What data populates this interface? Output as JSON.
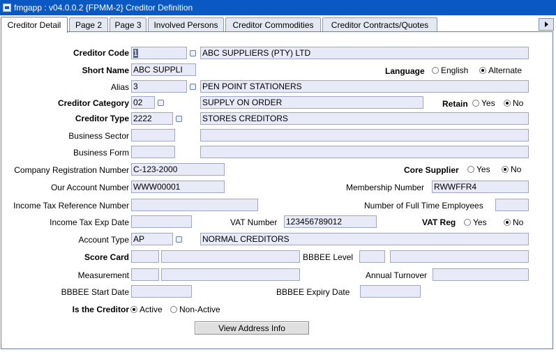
{
  "window": {
    "title": "fmgapp : v04.0.0.2  {FPMM-2} Creditor Definition"
  },
  "tabs": [
    {
      "label": "Creditor Detail"
    },
    {
      "label": "Page 2"
    },
    {
      "label": "Page 3"
    },
    {
      "label": "Involved Persons"
    },
    {
      "label": "Creditor Commodities"
    },
    {
      "label": "Creditor Contracts/Quotes"
    }
  ],
  "labels": {
    "creditor_code": "Creditor Code",
    "short_name": "Short Name",
    "alias": "Alias",
    "creditor_category": "Creditor Category",
    "creditor_type": "Creditor Type",
    "business_sector": "Business Sector",
    "business_form": "Business Form",
    "company_reg": "Company Registration Number",
    "our_account": "Our Account Number",
    "income_tax_ref": "Income Tax Reference Number",
    "income_tax_exp": "Income Tax Exp Date",
    "account_type": "Account Type",
    "score_card": "Score Card",
    "measurement": "Measurement",
    "bbbee_start": "BBBEE Start Date",
    "is_creditor": "Is the Creditor",
    "language": "Language",
    "retain": "Retain",
    "core_supplier": "Core Supplier",
    "membership": "Membership Number",
    "full_time_employees": "Number of Full Time Employees",
    "vat_number": "VAT Number",
    "vat_reg": "VAT Reg",
    "bbbee_level": "BBBEE Level",
    "annual_turnover": "Annual Turnover",
    "bbbee_expiry": "BBBEE Expiry Date"
  },
  "values": {
    "creditor_code": "1",
    "creditor_name": "ABC SUPPLIERS (PTY) LTD",
    "short_name": "ABC SUPPLI",
    "alias_code": "3",
    "alias_name": "PEN POINT STATIONERS",
    "category_code": "02",
    "category_name": "SUPPLY ON ORDER",
    "type_code": "2222",
    "type_name": "STORES CREDITORS",
    "company_reg": "C-123-2000",
    "our_account": "WWW00001",
    "membership": "RWWFFR4",
    "vat_number": "123456789012",
    "account_type_code": "AP",
    "account_type_name": "NORMAL CREDITORS"
  },
  "options": {
    "english": "English",
    "alternate": "Alternate",
    "yes": "Yes",
    "no": "No",
    "active": "Active",
    "non_active": "Non-Active"
  },
  "buttons": {
    "view_address": "View  Address Info"
  }
}
